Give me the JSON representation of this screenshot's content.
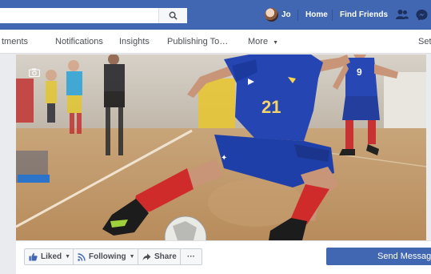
{
  "topbar": {
    "user_name": "Jo",
    "home": "Home",
    "find_friends": "Find Friends"
  },
  "tabs": {
    "t1": "tments",
    "t2": "Notifications",
    "t3": "Insights",
    "t4": "Publishing To…",
    "t5": "More",
    "t6": "Set"
  },
  "actions": {
    "liked": "Liked",
    "following": "Following",
    "share": "Share",
    "more": "···",
    "send_message": "Send Message"
  },
  "cover": {
    "player_number": "21",
    "player_number_back": "9"
  },
  "colors": {
    "brand_blue": "#4267b2",
    "jersey_blue": "#1f3fa8",
    "sock_red": "#cf2b2b"
  }
}
